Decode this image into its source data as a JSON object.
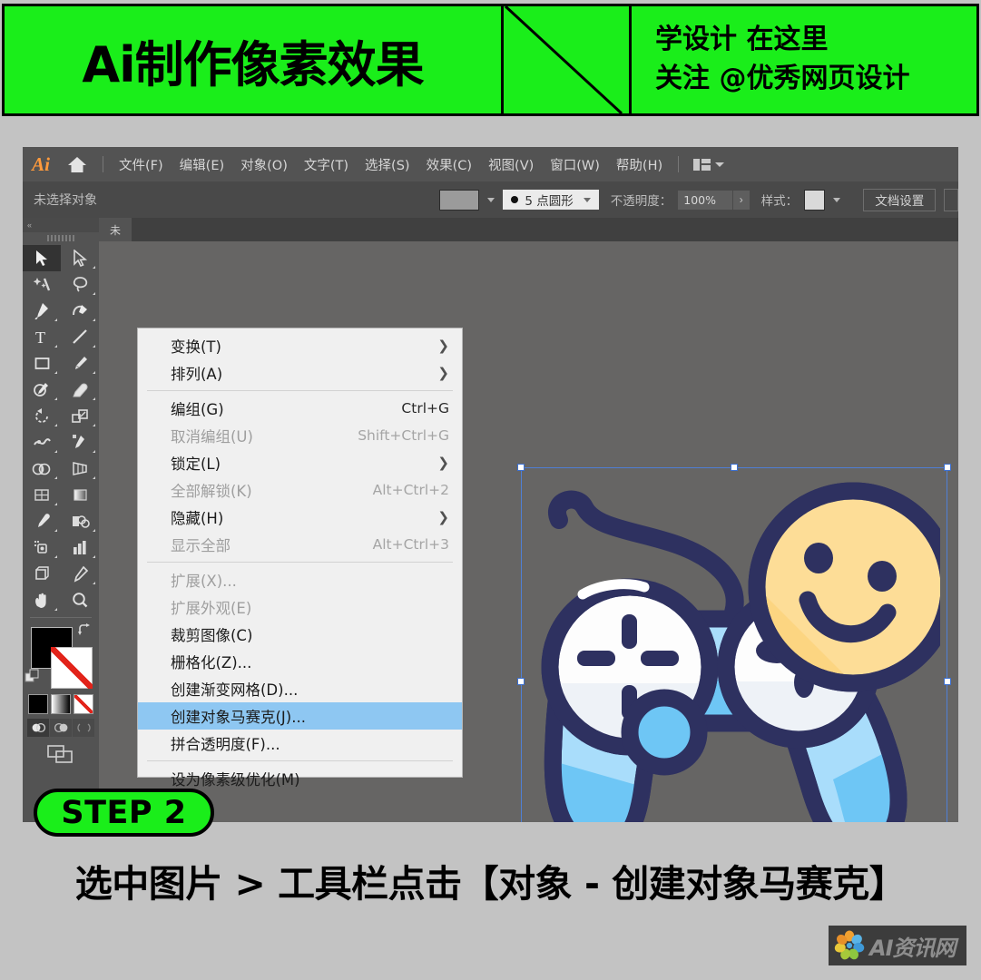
{
  "banner": {
    "left_title": "Ai制作像素效果",
    "diagonal_icon": "diagonal-slash-icon",
    "right_line1": "学设计 在这里",
    "right_line2": "关注 @优秀网页设计",
    "green": "#1aee1a"
  },
  "app": {
    "logo": "Ai",
    "home_icon": "home-icon",
    "arrange_icon": "arrange-documents-icon",
    "chevron_icon": "chevron-down-icon",
    "menus": [
      {
        "label": "文件(F)"
      },
      {
        "label": "编辑(E)"
      },
      {
        "label": "对象(O)"
      },
      {
        "label": "文字(T)"
      },
      {
        "label": "选择(S)"
      },
      {
        "label": "效果(C)"
      },
      {
        "label": "视图(V)"
      },
      {
        "label": "窗口(W)"
      },
      {
        "label": "帮助(H)"
      }
    ]
  },
  "control_bar": {
    "selection_status": "未选择对象",
    "fill_swatch_color": "#9b9b9b",
    "brush_dot_icon": "brush-dot-icon",
    "brush_value": "5 点圆形",
    "opacity_label": "不透明度：",
    "opacity_value": "100%",
    "opacity_arrow": "›",
    "style_label": "样式：",
    "style_swatch_color": "#d9d9d9",
    "document_setup": "文档设置"
  },
  "tab": {
    "document_label": "未"
  },
  "dropdown": {
    "items": [
      {
        "label": "变换(T)",
        "accel": "",
        "submenu": true,
        "disabled": false,
        "highlight": false
      },
      {
        "label": "排列(A)",
        "accel": "",
        "submenu": true,
        "disabled": false,
        "highlight": false
      },
      {
        "divider": true
      },
      {
        "label": "编组(G)",
        "accel": "Ctrl+G",
        "submenu": false,
        "disabled": false,
        "highlight": false
      },
      {
        "label": "取消编组(U)",
        "accel": "Shift+Ctrl+G",
        "submenu": false,
        "disabled": true,
        "highlight": false
      },
      {
        "label": "锁定(L)",
        "accel": "",
        "submenu": true,
        "disabled": false,
        "highlight": false
      },
      {
        "label": "全部解锁(K)",
        "accel": "Alt+Ctrl+2",
        "submenu": false,
        "disabled": true,
        "highlight": false
      },
      {
        "label": "隐藏(H)",
        "accel": "",
        "submenu": true,
        "disabled": false,
        "highlight": false
      },
      {
        "label": "显示全部",
        "accel": "Alt+Ctrl+3",
        "submenu": false,
        "disabled": true,
        "highlight": false
      },
      {
        "divider": true
      },
      {
        "label": "扩展(X)...",
        "accel": "",
        "submenu": false,
        "disabled": true,
        "highlight": false
      },
      {
        "label": "扩展外观(E)",
        "accel": "",
        "submenu": false,
        "disabled": true,
        "highlight": false
      },
      {
        "label": "裁剪图像(C)",
        "accel": "",
        "submenu": false,
        "disabled": false,
        "highlight": false
      },
      {
        "label": "栅格化(Z)...",
        "accel": "",
        "submenu": false,
        "disabled": false,
        "highlight": false
      },
      {
        "label": "创建渐变网格(D)...",
        "accel": "",
        "submenu": false,
        "disabled": false,
        "highlight": false
      },
      {
        "label": "创建对象马赛克(J)...",
        "accel": "",
        "submenu": false,
        "disabled": false,
        "highlight": true
      },
      {
        "label": "拼合透明度(F)...",
        "accel": "",
        "submenu": false,
        "disabled": false,
        "highlight": false
      },
      {
        "divider": true
      },
      {
        "label": "设为像素级优化(M)",
        "accel": "",
        "submenu": false,
        "disabled": false,
        "highlight": false
      }
    ]
  },
  "toolbar": {
    "tools": [
      {
        "name": "selection-tool",
        "active": true
      },
      {
        "name": "direct-selection-tool",
        "active": false
      },
      {
        "name": "magic-wand-tool",
        "active": false
      },
      {
        "name": "lasso-tool",
        "active": false
      },
      {
        "name": "pen-tool",
        "active": false
      },
      {
        "name": "curvature-tool",
        "active": false
      },
      {
        "name": "type-tool",
        "active": false
      },
      {
        "name": "line-segment-tool",
        "active": false
      },
      {
        "name": "rectangle-tool",
        "active": false
      },
      {
        "name": "paintbrush-tool",
        "active": false
      },
      {
        "name": "shaper-tool",
        "active": false
      },
      {
        "name": "eraser-tool",
        "active": false
      },
      {
        "name": "rotate-tool",
        "active": false
      },
      {
        "name": "scale-tool",
        "active": false
      },
      {
        "name": "width-tool",
        "active": false
      },
      {
        "name": "free-transform-tool",
        "active": false
      },
      {
        "name": "shape-builder-tool",
        "active": false
      },
      {
        "name": "perspective-grid-tool",
        "active": false
      },
      {
        "name": "mesh-tool",
        "active": false
      },
      {
        "name": "gradient-tool",
        "active": false
      },
      {
        "name": "eyedropper-tool",
        "active": false
      },
      {
        "name": "blend-tool",
        "active": false
      },
      {
        "name": "symbol-sprayer-tool",
        "active": false
      },
      {
        "name": "column-graph-tool",
        "active": false
      },
      {
        "name": "artboard-tool",
        "active": false
      },
      {
        "name": "slice-tool",
        "active": false
      },
      {
        "name": "hand-tool",
        "active": false
      },
      {
        "name": "zoom-tool",
        "active": false
      }
    ],
    "fill_color": "#000000",
    "stroke_color": "#ffffff",
    "swap-icon": "swap-fill-stroke-icon",
    "reset-icon": "default-fill-stroke-icon",
    "mode_color": "color-mode-icon",
    "mode_gradient": "gradient-mode-icon",
    "mode_none": "none-mode-icon",
    "draw_normal": "draw-normal-icon",
    "draw_behind": "draw-behind-icon",
    "draw_inside": "draw-inside-icon",
    "screen_mode": "screen-mode-icon"
  },
  "canvas": {
    "background": "#666564",
    "artwork_name": "gamepad-illustration",
    "selection_color": "#4f7fd6",
    "art_colors": {
      "outline": "#2e3160",
      "light_blue": "#a9ddfb",
      "mid_blue": "#6ec6f5",
      "white": "#fdfdfd",
      "off_white": "#eef2f7",
      "yellow": "#fcd581",
      "light_yellow": "#fde3a9"
    }
  },
  "step": {
    "badge_label": "STEP 2",
    "caption": "选中图片 > 工具栏点击【对象 - 创建对象马赛克】"
  },
  "watermark": {
    "logo": "flower-logo-icon",
    "text": "AI资讯网"
  }
}
